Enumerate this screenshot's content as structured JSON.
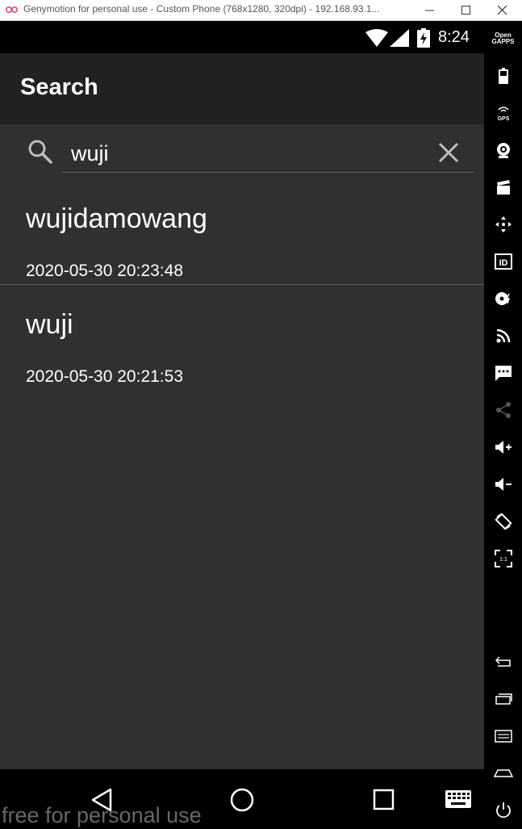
{
  "window": {
    "title": "Genymotion for personal use - Custom Phone (768x1280, 320dpi) - 192.168.93.1..."
  },
  "statusbar": {
    "time": "8:24"
  },
  "appbar": {
    "title": "Search"
  },
  "search": {
    "value": "wuji"
  },
  "results": [
    {
      "name": "wujidamowang",
      "date": "2020-05-30 20:23:48"
    },
    {
      "name": "wuji",
      "date": "2020-05-30 20:21:53"
    }
  ],
  "watermark": "free for personal use",
  "toolbar": {
    "open_gapps_line1": "Open",
    "open_gapps_line2": "GAPPS"
  },
  "colors": {
    "appbar": "#212121",
    "background": "#303030",
    "statusbar": "#000000"
  }
}
